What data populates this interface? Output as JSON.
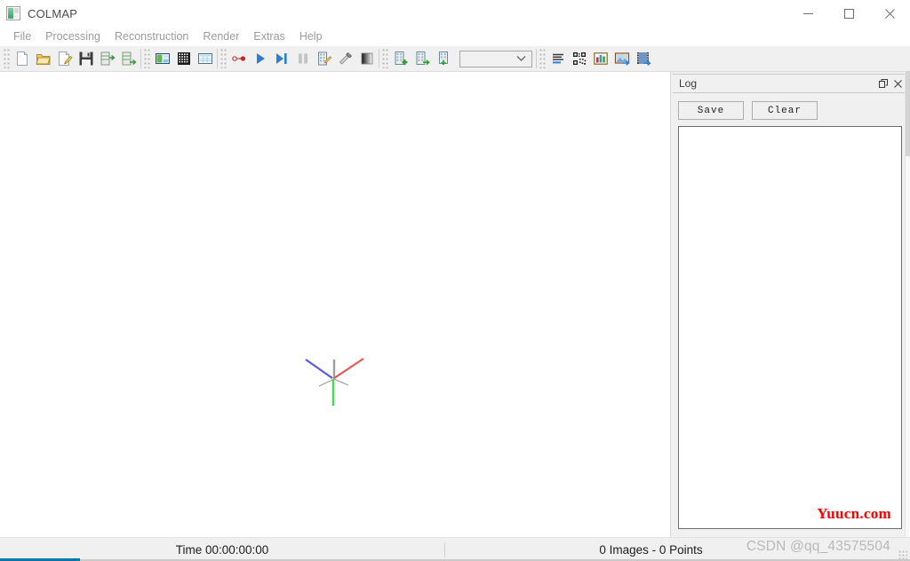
{
  "window": {
    "title": "COLMAP",
    "icon": "colmap-app-icon",
    "controls": {
      "minimize": "minimize-icon",
      "maximize": "maximize-icon",
      "close": "close-icon"
    }
  },
  "menubar": {
    "items": [
      {
        "label": "File"
      },
      {
        "label": "Processing"
      },
      {
        "label": "Reconstruction"
      },
      {
        "label": "Render"
      },
      {
        "label": "Extras"
      },
      {
        "label": "Help"
      }
    ]
  },
  "toolbar": {
    "groups": [
      {
        "buttons": [
          {
            "name": "new-project-button",
            "icon": "new-document-icon"
          },
          {
            "name": "open-project-button",
            "icon": "open-folder-icon"
          },
          {
            "name": "edit-project-button",
            "icon": "edit-document-icon"
          },
          {
            "name": "save-project-button",
            "icon": "floppy-save-icon"
          },
          {
            "name": "import-model-button",
            "icon": "import-database-icon"
          },
          {
            "name": "export-model-button",
            "icon": "export-database-icon"
          }
        ]
      },
      {
        "buttons": [
          {
            "name": "feature-extraction-button",
            "icon": "feature-extract-icon"
          },
          {
            "name": "feature-matching-button",
            "icon": "grid-matrix-icon"
          },
          {
            "name": "database-management-button",
            "icon": "table-database-icon"
          }
        ]
      },
      {
        "buttons": [
          {
            "name": "automatic-reconstruction-button",
            "icon": "node-link-icon"
          },
          {
            "name": "start-reconstruction-button",
            "icon": "play-icon"
          },
          {
            "name": "step-reconstruction-button",
            "icon": "step-forward-icon"
          },
          {
            "name": "pause-reconstruction-button",
            "icon": "pause-icon"
          },
          {
            "name": "bundle-adjustment-button",
            "icon": "edit-building-icon"
          },
          {
            "name": "dense-reconstruction-button",
            "icon": "hammer-icon"
          },
          {
            "name": "render-options-button",
            "icon": "gradient-square-icon"
          }
        ]
      },
      {
        "buttons": [
          {
            "name": "add-model-button",
            "icon": "building-add-icon"
          },
          {
            "name": "next-model-button",
            "icon": "building-next-icon"
          },
          {
            "name": "model-stats-button",
            "icon": "building-stats-icon"
          }
        ],
        "combo": {
          "name": "model-selector-combo",
          "value": "",
          "chevron": "chevron-down-icon"
        }
      },
      {
        "buttons": [
          {
            "name": "show-log-button",
            "icon": "text-lines-icon"
          },
          {
            "name": "match-matrix-button",
            "icon": "qr-matrix-icon"
          },
          {
            "name": "model-statistics-button",
            "icon": "bar-chart-icon"
          },
          {
            "name": "export-image-button",
            "icon": "image-export-icon"
          },
          {
            "name": "export-movie-button",
            "icon": "film-export-icon"
          }
        ]
      }
    ]
  },
  "viewport": {
    "name": "3d-model-viewport",
    "axes": {
      "x_color": "#e05a5a",
      "y_color": "#55d455",
      "z_color": "#5a5ae0",
      "shadow_color": "#9e9e9e"
    }
  },
  "log_dock": {
    "title": "Log",
    "float_icon": "float-window-icon",
    "close_icon": "close-icon",
    "save_label": "Save",
    "clear_label": "Clear",
    "content": ""
  },
  "watermarks": {
    "yuucn": "Yuucn.com",
    "csdn": "CSDN @qq_43575504"
  },
  "statusbar": {
    "time_label": "Time 00:00:00:00",
    "counts_label": "0 Images - 0 Points"
  }
}
